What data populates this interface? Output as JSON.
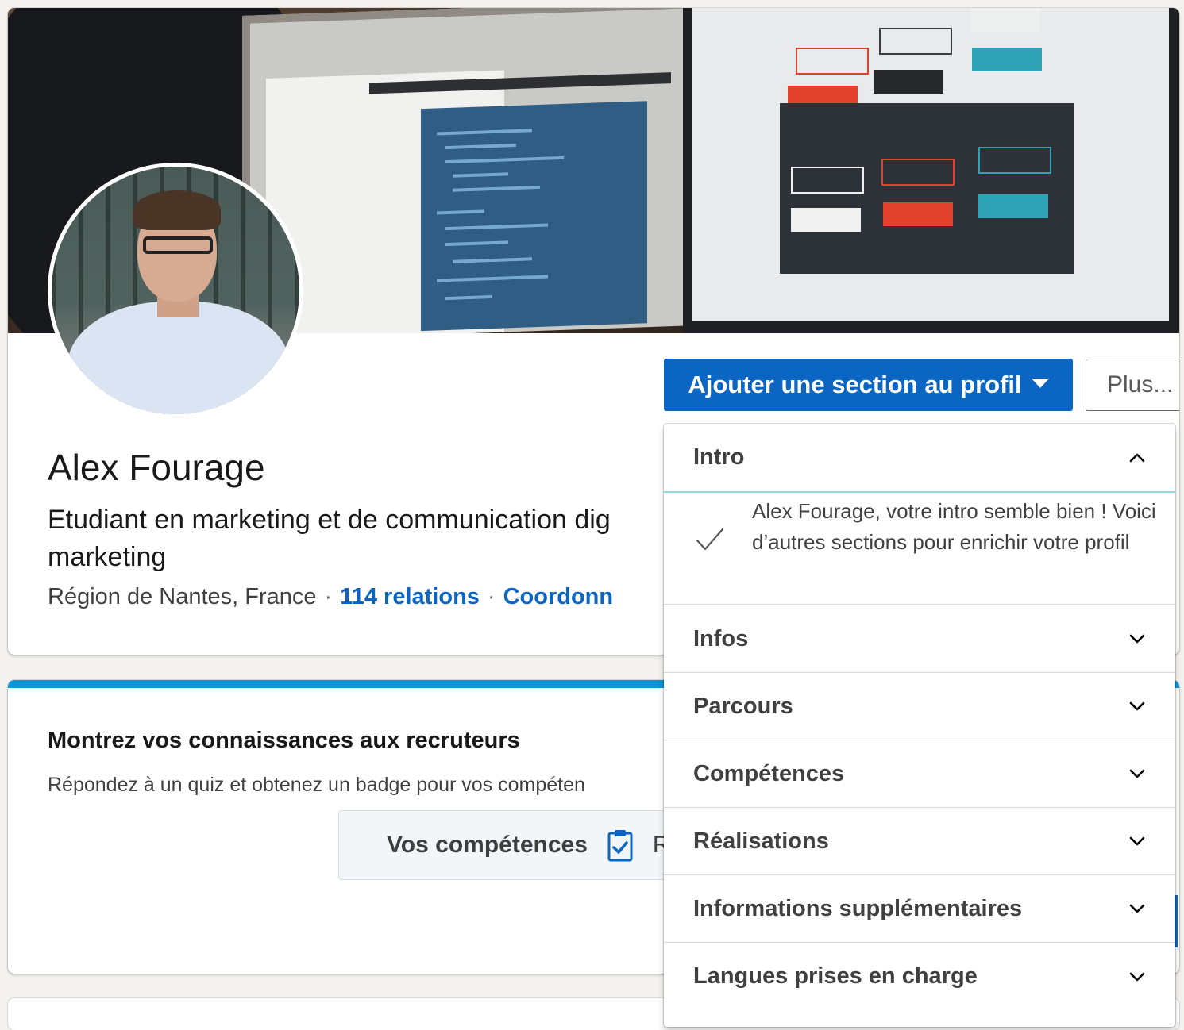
{
  "profile": {
    "name": "Alex Fourage",
    "headline": "Etudiant en marketing et de communication dig marketing",
    "location": "Région de Nantes, France",
    "separator": "·",
    "connections": "114 relations",
    "contact_info": "Coordonn"
  },
  "actions": {
    "add_section_label": "Ajouter une section au profil",
    "more_label": "Plus..."
  },
  "quiz": {
    "title": "Montrez vos connaissances aux recruteurs",
    "subtitle": "Répondez à un quiz et obtenez un badge pour vos compéten",
    "button_label": "Vos compétences",
    "button_tail": "R"
  },
  "dropdown": {
    "sections": [
      {
        "label": "Intro",
        "expanded": true,
        "icon": "chevron-up-icon"
      },
      {
        "label": "Infos",
        "expanded": false,
        "icon": "chevron-down-icon"
      },
      {
        "label": "Parcours",
        "expanded": false,
        "icon": "chevron-down-icon"
      },
      {
        "label": "Compétences",
        "expanded": false,
        "icon": "chevron-down-icon"
      },
      {
        "label": "Réalisations",
        "expanded": false,
        "icon": "chevron-down-icon"
      },
      {
        "label": "Informations supplémentaires",
        "expanded": false,
        "icon": "chevron-down-icon"
      },
      {
        "label": "Langues prises en charge",
        "expanded": false,
        "icon": "chevron-down-icon"
      }
    ],
    "intro_message": "Alex Fourage, votre intro semble bien ! Voici d’autres sections pour enrichir votre profil"
  },
  "colors": {
    "primary": "#0a66c2",
    "accent_bar": "#0a95d6",
    "open_section_underline": "#8fd8e4",
    "page_background": "#f3f2ef"
  }
}
